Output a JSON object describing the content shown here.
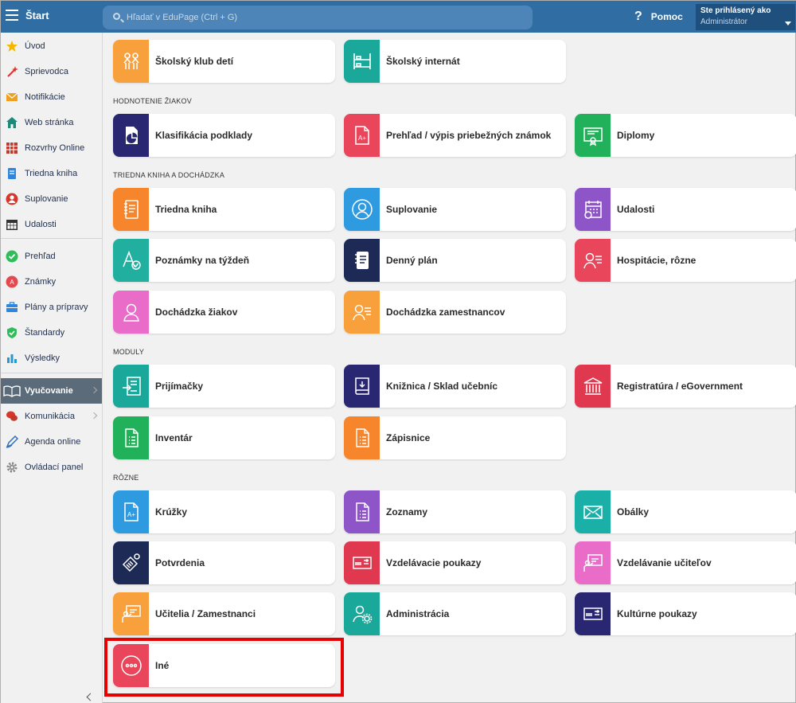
{
  "header": {
    "menu_icon": "hamburger-icon",
    "title": "Štart",
    "search_placeholder": "Hľadať v EduPage (Ctrl + G)",
    "help_icon": "question-icon",
    "help_label": "Pomoc",
    "user_line1": "Ste prihlásený ako",
    "user_line2": "Administrátor"
  },
  "sidebar": {
    "items": [
      {
        "label": "Úvod",
        "icon": "star-icon",
        "color": "#f5b800"
      },
      {
        "label": "Sprievodca",
        "icon": "wand-icon",
        "color": "#d9352b"
      },
      {
        "label": "Notifikácie",
        "icon": "envelope-icon",
        "color": "#f0a020"
      },
      {
        "label": "Web stránka",
        "icon": "house-icon",
        "color": "#1a8a7a"
      },
      {
        "label": "Rozvrhy Online",
        "icon": "timetable-icon",
        "color": "#c0392b"
      },
      {
        "label": "Triedna kniha",
        "icon": "book-icon",
        "color": "#2e86de"
      },
      {
        "label": "Suplovanie",
        "icon": "person-icon",
        "color": "#d9352b"
      },
      {
        "label": "Udalosti",
        "icon": "calendar-icon",
        "color": "#333333"
      },
      {
        "label": "Prehľad",
        "icon": "check-circle-icon",
        "color": "#2ebd59"
      },
      {
        "label": "Známky",
        "icon": "grade-icon",
        "color": "#e5484d"
      },
      {
        "label": "Plány a prípravy",
        "icon": "briefcase-icon",
        "color": "#2e86de"
      },
      {
        "label": "Štandardy",
        "icon": "shield-check-icon",
        "color": "#2ebd59"
      },
      {
        "label": "Výsledky",
        "icon": "bar-chart-icon",
        "color": "#1e9bd7"
      },
      {
        "label": "Vyučovanie",
        "icon": "open-book-icon",
        "color": "#ffffff"
      },
      {
        "label": "Komunikácia",
        "icon": "chat-icon",
        "color": "#d9352b"
      },
      {
        "label": "Agenda online",
        "icon": "pen-icon",
        "color": "#2e6fc0"
      },
      {
        "label": "Ovládací panel",
        "icon": "gear-icon",
        "color": "#888888"
      }
    ]
  },
  "sections": {
    "hodnotenie": "HODNOTENIE ŽIAKOV",
    "triedna": "TRIEDNA KNIHA A DOCHÁDZKA",
    "moduly": "MODULY",
    "rozne": "RÔZNE"
  },
  "tiles": {
    "skolsky_klub": {
      "label": "Školský klub detí",
      "icon": "children-icon",
      "color": "#f7a03c"
    },
    "skolsky_internat": {
      "label": "Školský internát",
      "icon": "bunk-bed-icon",
      "color": "#1aa89a"
    },
    "klasifikacia": {
      "label": "Klasifikácia podklady",
      "icon": "pie-report-icon",
      "color": "#2a2772"
    },
    "prehlad_znamok": {
      "label": "Prehľad / výpis priebežných známok",
      "icon": "grade-document-icon",
      "color": "#e9455b"
    },
    "diplomy": {
      "label": "Diplomy",
      "icon": "diploma-icon",
      "color": "#21b15a"
    },
    "triedna_kniha": {
      "label": "Triedna kniha",
      "icon": "notebook-icon",
      "color": "#f7852b"
    },
    "suplovanie": {
      "label": "Suplovanie",
      "icon": "person-circle-icon",
      "color": "#2e9ae0"
    },
    "udalosti": {
      "label": "Udalosti",
      "icon": "calendar-icon",
      "color": "#8e55c8"
    },
    "poznamky": {
      "label": "Poznámky na týždeň",
      "icon": "font-check-icon",
      "color": "#21b0a0"
    },
    "denny_plan": {
      "label": "Denný plán",
      "icon": "planner-icon",
      "color": "#1c2a55"
    },
    "hospitacie": {
      "label": "Hospitácie, rôzne",
      "icon": "person-list-icon",
      "color": "#e9455b"
    },
    "dochadzka_ziakov": {
      "label": "Dochádzka žiakov",
      "icon": "person-icon",
      "color": "#e86cc8"
    },
    "dochadzka_zamestnancov": {
      "label": "Dochádzka zamestnancov",
      "icon": "person-list-icon",
      "color": "#f7a03c"
    },
    "prijimacky": {
      "label": "Prijímačky",
      "icon": "enter-form-icon",
      "color": "#1aa89a"
    },
    "kniznica": {
      "label": "Knižnica / Sklad učebníc",
      "icon": "book-download-icon",
      "color": "#2a2772"
    },
    "registratura": {
      "label": "Registratúra / eGovernment",
      "icon": "institution-icon",
      "color": "#e0384e"
    },
    "inventar": {
      "label": "Inventár",
      "icon": "list-document-icon",
      "color": "#21b15a"
    },
    "zapisnice": {
      "label": "Zápisnice",
      "icon": "list-document-icon",
      "color": "#f7852b"
    },
    "kruzky": {
      "label": "Krúžky",
      "icon": "grade-document-icon",
      "color": "#2e9ae0"
    },
    "zoznamy": {
      "label": "Zoznamy",
      "icon": "list-document-icon",
      "color": "#8e55c8"
    },
    "obalky": {
      "label": "Obálky",
      "icon": "envelope-icon",
      "color": "#1ab0a8"
    },
    "potvrdenia": {
      "label": "Potvrdenia",
      "icon": "stamp-icon",
      "color": "#1c2a55"
    },
    "vzdelavacie_poukazy": {
      "label": "Vzdelávacie poukazy",
      "icon": "voucher-icon",
      "color": "#e0384e"
    },
    "vzdelavanie_ucitelov": {
      "label": "Vzdelávanie učiteľov",
      "icon": "teacher-board-icon",
      "color": "#e86cc8"
    },
    "ucitelia": {
      "label": "Učitelia / Zamestnanci",
      "icon": "teacher-board-icon",
      "color": "#f7a03c"
    },
    "administracia": {
      "label": "Administrácia",
      "icon": "person-gear-icon",
      "color": "#1aa89a"
    },
    "kulturne_poukazy": {
      "label": "Kultúrne poukazy",
      "icon": "voucher-icon",
      "color": "#2a2772"
    },
    "ine": {
      "label": "Iné",
      "icon": "more-dots-icon",
      "color": "#e9455b"
    }
  }
}
